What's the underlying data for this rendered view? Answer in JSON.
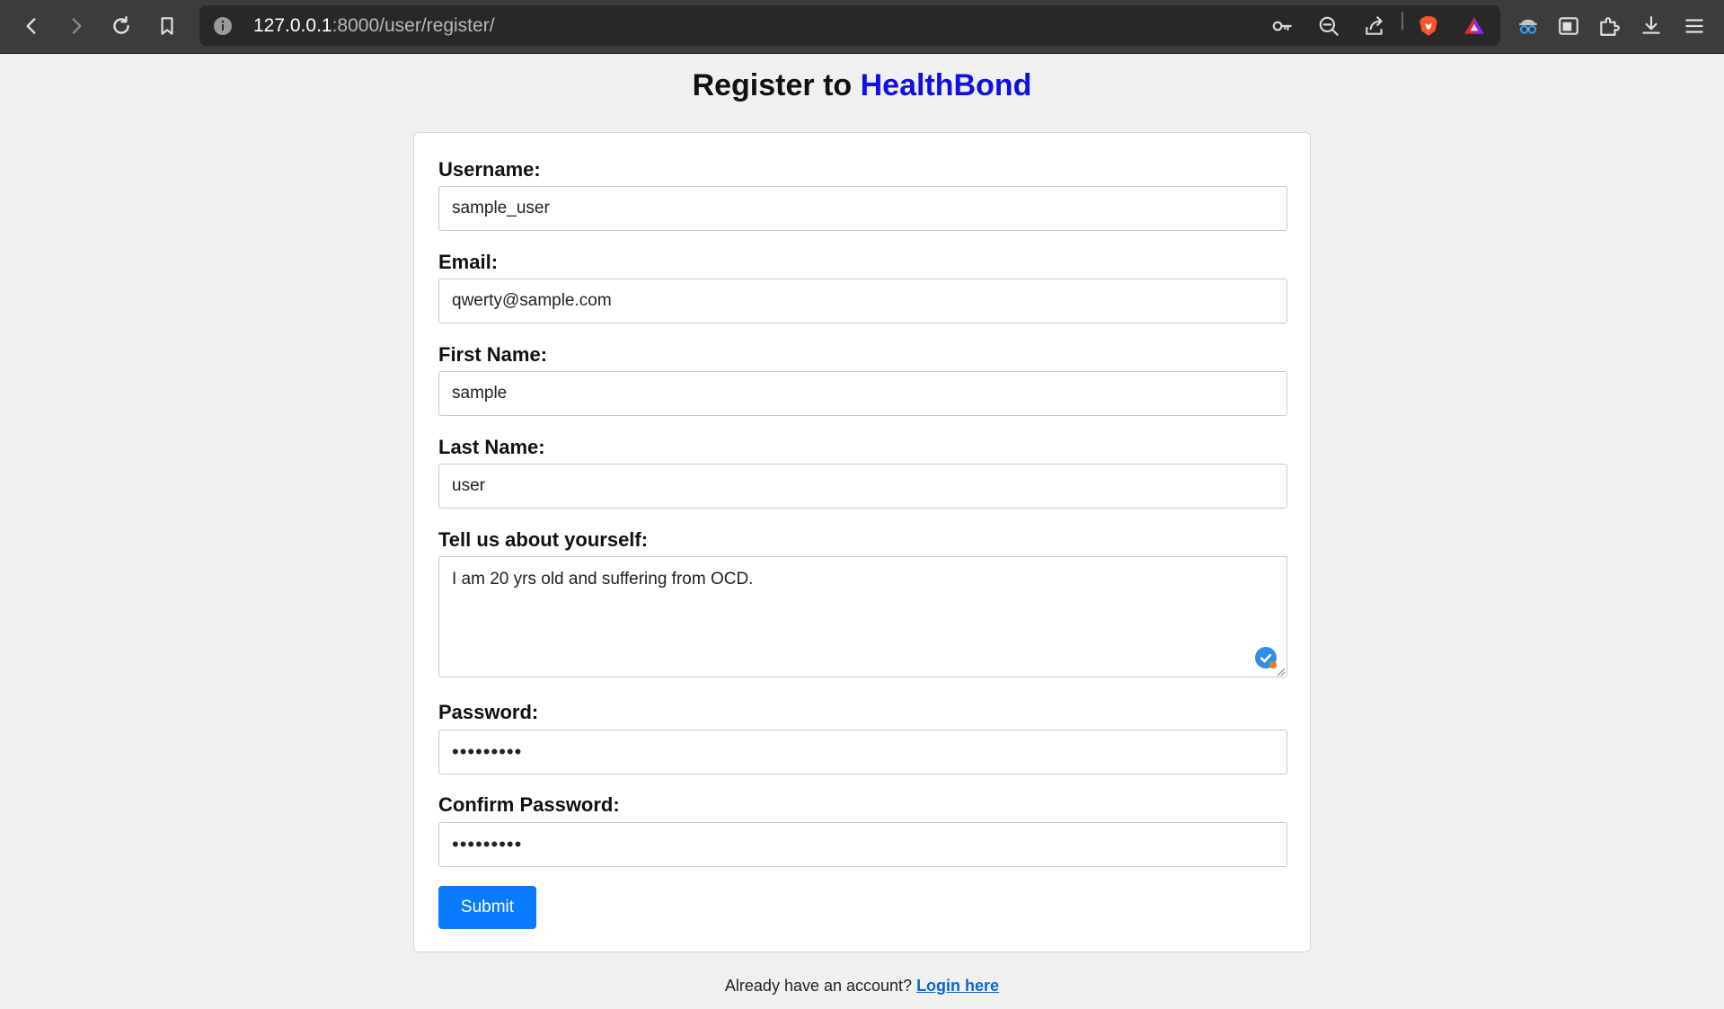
{
  "browser": {
    "url_host": "127.0.0.1",
    "url_path": ":8000/user/register/",
    "icons": {
      "back": "back-arrow-icon",
      "forward": "forward-arrow-icon",
      "reload": "reload-icon",
      "bookmark": "bookmark-icon",
      "site_info": "info-icon",
      "password_key": "key-icon",
      "zoom": "zoom-out-icon",
      "share": "share-icon",
      "brave_shield": "brave-lion-icon",
      "rewards": "rewards-triangle-icon",
      "incognito_ext": "spy-glasses-icon",
      "sidebar": "sidebar-icon",
      "extensions": "puzzle-icon",
      "downloads": "download-icon",
      "menu": "hamburger-menu-icon"
    },
    "colors": {
      "chrome_bg": "#3c3c3c",
      "urlbar_bg": "#282828",
      "brave_orange": "#fb542b"
    }
  },
  "page": {
    "title_prefix": "Register to ",
    "title_brand": "HealthBond",
    "brand_color": "#1010e0"
  },
  "form": {
    "username_label": "Username:",
    "username_value": "sample_user",
    "email_label": "Email:",
    "email_value": "qwerty@sample.com",
    "first_name_label": "First Name:",
    "first_name_value": "sample",
    "last_name_label": "Last Name:",
    "last_name_value": "user",
    "about_label": "Tell us about yourself:",
    "about_value": "I am 20 yrs old and suffering from OCD.",
    "password_label": "Password:",
    "password_value": "•••••••••",
    "confirm_password_label": "Confirm Password:",
    "confirm_password_value": "•••••••••",
    "submit_label": "Submit",
    "submit_color": "#0a7bff"
  },
  "footer": {
    "prompt": "Already have an account? ",
    "login_link": "Login here"
  }
}
